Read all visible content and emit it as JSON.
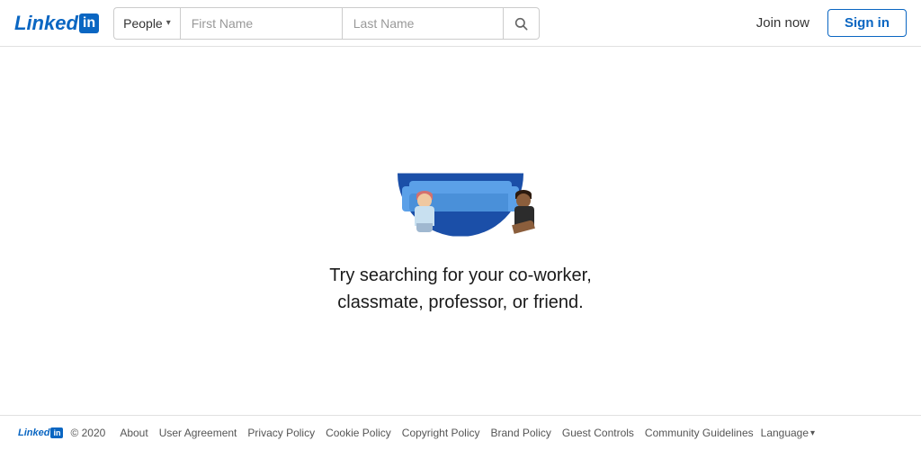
{
  "header": {
    "logo_text": "Linked",
    "logo_in": "in",
    "search": {
      "category_label": "People",
      "first_name_placeholder": "First Name",
      "last_name_placeholder": "Last Name"
    },
    "join_now_label": "Join now",
    "sign_in_label": "Sign in"
  },
  "main": {
    "prompt_line1": "Try searching for your co-worker,",
    "prompt_line2": "classmate, professor, or friend."
  },
  "footer": {
    "logo_text": "Linked",
    "logo_in": "in",
    "copyright": "© 2020",
    "links": [
      "About",
      "User Agreement",
      "Privacy Policy",
      "Cookie Policy",
      "Copyright Policy",
      "Brand Policy",
      "Guest Controls",
      "Community Guidelines"
    ],
    "language_label": "Language"
  }
}
